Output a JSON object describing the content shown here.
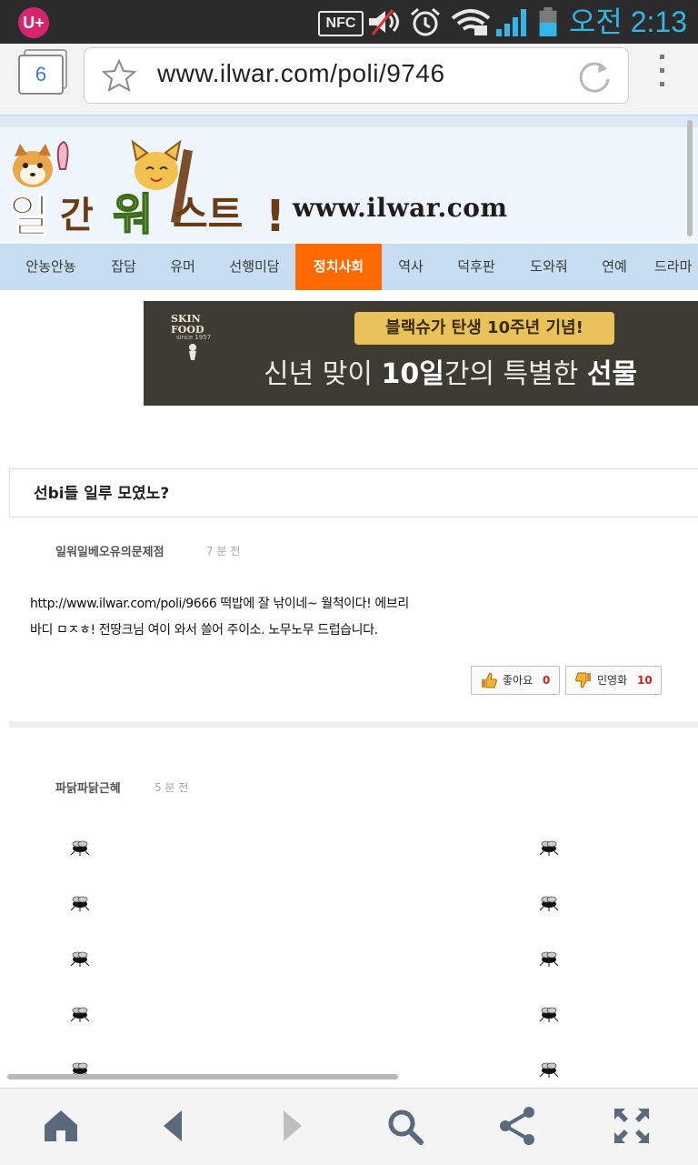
{
  "status_bar": {
    "carrier_logo": "U+",
    "nfc_label": "NFC",
    "time": "오전 2:13",
    "icons": [
      "nfc-icon",
      "mute-icon",
      "alarm-icon",
      "wifi-icon",
      "signal-icon",
      "battery-icon"
    ]
  },
  "browser": {
    "tab_count": "6",
    "url": "www.ilwar.com/poli/9746",
    "icons": [
      "bookmark-star-icon",
      "reload-icon",
      "overflow-menu-icon"
    ]
  },
  "site": {
    "logo_text": "일간워스트!",
    "logo_url": "www.ilwar.com",
    "nav": [
      {
        "label": "안농안뇽",
        "active": false
      },
      {
        "label": "잡담",
        "active": false
      },
      {
        "label": "유머",
        "active": false
      },
      {
        "label": "선행미담",
        "active": false
      },
      {
        "label": "정치사회",
        "active": true
      },
      {
        "label": "역사",
        "active": false
      },
      {
        "label": "덕후판",
        "active": false
      },
      {
        "label": "도와줘",
        "active": false
      },
      {
        "label": "연예",
        "active": false
      },
      {
        "label": "드라마",
        "active": false
      }
    ],
    "accent_color": "#ff6a00",
    "nav_bg_color": "#c6ddf2"
  },
  "banner": {
    "brand": "SKIN FOOD",
    "since": "since 1957",
    "ribbon": "블랙슈가 탄생 10주년 기념!",
    "headline_prefix": "신년 맞이 ",
    "headline_bold": "10일",
    "headline_mid": "간의 특별한 ",
    "headline_end": "선물"
  },
  "post": {
    "title": "선bi들 일루 모였노?",
    "author": "일워일베오유의문제점",
    "time": "7 분 전",
    "body_line1": "http://www.ilwar.com/poli/9666 떡밥에 잘 낚이네~ 월척이다! 에브리",
    "body_line2": "바디 ㅁㅈㅎ! 전땅크님 여이 와서 쓸어 주이소. 노무노무 드럽습니다.",
    "like_label": "좋아요",
    "like_count": "0",
    "dislike_label": "민영화",
    "dislike_count": "10"
  },
  "comment": {
    "author": "파닭파닭근혜",
    "time": "5 분 전"
  },
  "toolbar": {
    "icons": [
      "home-icon",
      "back-icon",
      "forward-icon",
      "search-icon",
      "share-icon",
      "fullscreen-icon"
    ]
  }
}
